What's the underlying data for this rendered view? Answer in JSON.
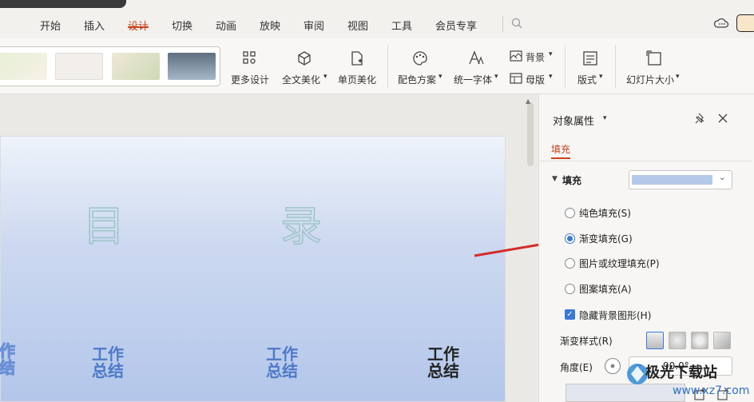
{
  "menu": {
    "items": [
      "开始",
      "插入",
      "设计",
      "切换",
      "动画",
      "放映",
      "审阅",
      "视图",
      "工具",
      "会员专享"
    ],
    "active": "设计"
  },
  "ribbon": {
    "more_design": "更多设计",
    "full_beautify": "全文美化",
    "page_beautify": "单页美化",
    "color_scheme": "配色方案",
    "unify_font": "统一字体",
    "background": "背景",
    "master": "母版",
    "layout": "版式",
    "slide_size": "幻灯片大小"
  },
  "slide": {
    "title_left": "目",
    "title_right": "录",
    "grid_items": [
      {
        "line1": "工作",
        "line2": "总结"
      },
      {
        "line1": "工作",
        "line2": "总结"
      },
      {
        "line1": "工作",
        "line2": "总结"
      },
      {
        "line1": "工作",
        "line2": "总结"
      }
    ]
  },
  "panel": {
    "title": "对象属性",
    "tab": "填充",
    "section": "填充",
    "options": [
      "纯色填充(S)",
      "渐变填充(G)",
      "图片或纹理填充(P)",
      "图案填充(A)"
    ],
    "selected_option": "渐变填充(G)",
    "hide_bg_label": "隐藏背景图形(H)",
    "gradient_style_label": "渐变样式(R)",
    "angle_label": "角度(E)",
    "angle_value": "90.0°"
  },
  "watermark": {
    "text": "极光下载站",
    "url": "www.xz7.com"
  },
  "colors": {
    "accent": "#c8431f",
    "radio_blue": "#3b78d8",
    "grid_label_blue": "#4e79c7",
    "grid_label_dark": "#222222",
    "arrow_red": "#d42a2a"
  }
}
